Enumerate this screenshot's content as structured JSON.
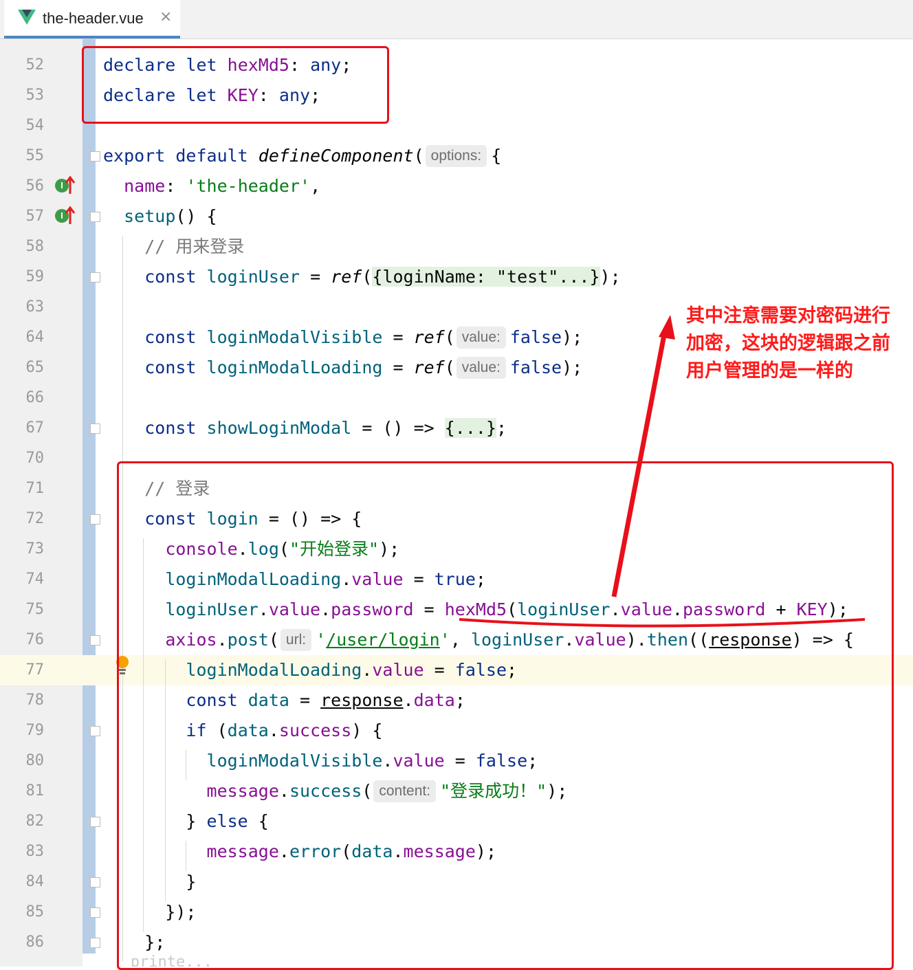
{
  "tab": {
    "file_name": "the-header.vue",
    "close_glyph": "×",
    "icon": "vue-logo-icon"
  },
  "editor": {
    "current_line": "77",
    "lines": [
      {
        "n": "52",
        "tokens": [
          [
            "kw",
            "declare"
          ],
          [
            "t",
            " "
          ],
          [
            "kw",
            "let"
          ],
          [
            "t",
            " "
          ],
          [
            "var",
            "hexMd5"
          ],
          [
            "t",
            ": "
          ],
          [
            "kw",
            "any"
          ],
          [
            "t",
            ";"
          ]
        ]
      },
      {
        "n": "53",
        "tokens": [
          [
            "kw",
            "declare"
          ],
          [
            "t",
            " "
          ],
          [
            "kw",
            "let"
          ],
          [
            "t",
            " "
          ],
          [
            "var",
            "KEY"
          ],
          [
            "t",
            ": "
          ],
          [
            "kw",
            "any"
          ],
          [
            "t",
            ";"
          ]
        ]
      },
      {
        "n": "54",
        "tokens": []
      },
      {
        "n": "55",
        "tokens": [
          [
            "kw",
            "export"
          ],
          [
            "t",
            " "
          ],
          [
            "kw",
            "default"
          ],
          [
            "t",
            " "
          ],
          [
            "fni",
            "defineComponent"
          ],
          [
            "t",
            "("
          ],
          [
            "hint",
            "options:"
          ],
          [
            "t",
            "{"
          ]
        ]
      },
      {
        "n": "56",
        "tokens": [
          [
            "t",
            "  "
          ],
          [
            "var",
            "name"
          ],
          [
            "t",
            ": "
          ],
          [
            "str",
            "'the-header'"
          ],
          [
            "t",
            ","
          ]
        ]
      },
      {
        "n": "57",
        "tokens": [
          [
            "t",
            "  "
          ],
          [
            "fn",
            "setup"
          ],
          [
            "t",
            "() {"
          ]
        ]
      },
      {
        "n": "58",
        "tokens": [
          [
            "t",
            "    "
          ],
          [
            "cm",
            "// 用来登录"
          ]
        ]
      },
      {
        "n": "59",
        "tokens": [
          [
            "t",
            "    "
          ],
          [
            "kw",
            "const"
          ],
          [
            "t",
            " "
          ],
          [
            "fn",
            "loginUser"
          ],
          [
            "t",
            " = "
          ],
          [
            "fni",
            "ref"
          ],
          [
            "t",
            "("
          ],
          [
            "fold",
            "{loginName: \"test\"...}"
          ],
          [
            "t",
            ");"
          ]
        ]
      },
      {
        "n": "63",
        "tokens": []
      },
      {
        "n": "64",
        "tokens": [
          [
            "t",
            "    "
          ],
          [
            "kw",
            "const"
          ],
          [
            "t",
            " "
          ],
          [
            "fn",
            "loginModalVisible"
          ],
          [
            "t",
            " = "
          ],
          [
            "fni",
            "ref"
          ],
          [
            "t",
            "("
          ],
          [
            "hint",
            "value:"
          ],
          [
            "kw",
            "false"
          ],
          [
            "t",
            ");"
          ]
        ]
      },
      {
        "n": "65",
        "tokens": [
          [
            "t",
            "    "
          ],
          [
            "kw",
            "const"
          ],
          [
            "t",
            " "
          ],
          [
            "fn",
            "loginModalLoading"
          ],
          [
            "t",
            " = "
          ],
          [
            "fni",
            "ref"
          ],
          [
            "t",
            "("
          ],
          [
            "hint",
            "value:"
          ],
          [
            "kw",
            "false"
          ],
          [
            "t",
            ");"
          ]
        ]
      },
      {
        "n": "66",
        "tokens": []
      },
      {
        "n": "67",
        "tokens": [
          [
            "t",
            "    "
          ],
          [
            "kw",
            "const"
          ],
          [
            "t",
            " "
          ],
          [
            "fn",
            "showLoginModal"
          ],
          [
            "t",
            " = () => "
          ],
          [
            "fold",
            "{...}"
          ],
          [
            "t",
            ";"
          ]
        ]
      },
      {
        "n": "70",
        "tokens": []
      },
      {
        "n": "71",
        "tokens": [
          [
            "t",
            "    "
          ],
          [
            "cm",
            "// 登录"
          ]
        ]
      },
      {
        "n": "72",
        "tokens": [
          [
            "t",
            "    "
          ],
          [
            "kw",
            "const"
          ],
          [
            "t",
            " "
          ],
          [
            "fn",
            "login"
          ],
          [
            "t",
            " = () => {"
          ]
        ]
      },
      {
        "n": "73",
        "tokens": [
          [
            "t",
            "      "
          ],
          [
            "var",
            "console"
          ],
          [
            "t",
            "."
          ],
          [
            "fn",
            "log"
          ],
          [
            "t",
            "("
          ],
          [
            "str",
            "\"开始登录\""
          ],
          [
            "t",
            ");"
          ]
        ]
      },
      {
        "n": "74",
        "tokens": [
          [
            "t",
            "      "
          ],
          [
            "fn",
            "loginModalLoading"
          ],
          [
            "t",
            "."
          ],
          [
            "var",
            "value"
          ],
          [
            "t",
            " = "
          ],
          [
            "kw",
            "true"
          ],
          [
            "t",
            ";"
          ]
        ]
      },
      {
        "n": "75",
        "tokens": [
          [
            "t",
            "      "
          ],
          [
            "fn",
            "loginUser"
          ],
          [
            "t",
            "."
          ],
          [
            "var",
            "value"
          ],
          [
            "t",
            "."
          ],
          [
            "var",
            "password"
          ],
          [
            "t",
            " = "
          ],
          [
            "var",
            "hexMd5"
          ],
          [
            "t",
            "("
          ],
          [
            "fn",
            "loginUser"
          ],
          [
            "t",
            "."
          ],
          [
            "var",
            "value"
          ],
          [
            "t",
            "."
          ],
          [
            "var",
            "password"
          ],
          [
            "t",
            " + "
          ],
          [
            "var",
            "KEY"
          ],
          [
            "t",
            ");"
          ]
        ]
      },
      {
        "n": "76",
        "tokens": [
          [
            "t",
            "      "
          ],
          [
            "var",
            "axios"
          ],
          [
            "t",
            "."
          ],
          [
            "fn",
            "post"
          ],
          [
            "t",
            "("
          ],
          [
            "hint",
            "url:"
          ],
          [
            "str",
            "'"
          ],
          [
            "stru",
            "/user/login"
          ],
          [
            "str",
            "'"
          ],
          [
            "t",
            ", "
          ],
          [
            "fn",
            "loginUser"
          ],
          [
            "t",
            "."
          ],
          [
            "var",
            "value"
          ],
          [
            "t",
            ")."
          ],
          [
            "fn",
            "then"
          ],
          [
            "t",
            "(("
          ],
          [
            "u",
            "response"
          ],
          [
            "t",
            ") => {"
          ]
        ]
      },
      {
        "n": "77",
        "tokens": [
          [
            "t",
            "        "
          ],
          [
            "fn",
            "loginModalLoading"
          ],
          [
            "t",
            "."
          ],
          [
            "var",
            "value"
          ],
          [
            "t",
            " = "
          ],
          [
            "kw",
            "false"
          ],
          [
            "t",
            ";"
          ]
        ]
      },
      {
        "n": "78",
        "tokens": [
          [
            "t",
            "        "
          ],
          [
            "kw",
            "const"
          ],
          [
            "t",
            " "
          ],
          [
            "fn",
            "data"
          ],
          [
            "t",
            " = "
          ],
          [
            "u",
            "response"
          ],
          [
            "t",
            "."
          ],
          [
            "var",
            "data"
          ],
          [
            "t",
            ";"
          ]
        ]
      },
      {
        "n": "79",
        "tokens": [
          [
            "t",
            "        "
          ],
          [
            "kw",
            "if"
          ],
          [
            "t",
            " ("
          ],
          [
            "fn",
            "data"
          ],
          [
            "t",
            "."
          ],
          [
            "var",
            "success"
          ],
          [
            "t",
            ") {"
          ]
        ]
      },
      {
        "n": "80",
        "tokens": [
          [
            "t",
            "          "
          ],
          [
            "fn",
            "loginModalVisible"
          ],
          [
            "t",
            "."
          ],
          [
            "var",
            "value"
          ],
          [
            "t",
            " = "
          ],
          [
            "kw",
            "false"
          ],
          [
            "t",
            ";"
          ]
        ]
      },
      {
        "n": "81",
        "tokens": [
          [
            "t",
            "          "
          ],
          [
            "var",
            "message"
          ],
          [
            "t",
            "."
          ],
          [
            "fn",
            "success"
          ],
          [
            "t",
            "("
          ],
          [
            "hint",
            "content:"
          ],
          [
            "str",
            "\"登录成功！\""
          ],
          [
            "t",
            ");"
          ]
        ]
      },
      {
        "n": "82",
        "tokens": [
          [
            "t",
            "        } "
          ],
          [
            "kw",
            "else"
          ],
          [
            "t",
            " {"
          ]
        ]
      },
      {
        "n": "83",
        "tokens": [
          [
            "t",
            "          "
          ],
          [
            "var",
            "message"
          ],
          [
            "t",
            "."
          ],
          [
            "fn",
            "error"
          ],
          [
            "t",
            "("
          ],
          [
            "fn",
            "data"
          ],
          [
            "t",
            "."
          ],
          [
            "var",
            "message"
          ],
          [
            "t",
            ");"
          ]
        ]
      },
      {
        "n": "84",
        "tokens": [
          [
            "t",
            "        }"
          ]
        ]
      },
      {
        "n": "85",
        "tokens": [
          [
            "t",
            "      });"
          ]
        ]
      },
      {
        "n": "86",
        "tokens": [
          [
            "t",
            "    };"
          ]
        ]
      }
    ]
  },
  "annotation": {
    "text": "其中注意需要对密码进行加密，这块的逻辑跟之前用户管理的是一样的",
    "color": "#ff1a1a"
  }
}
